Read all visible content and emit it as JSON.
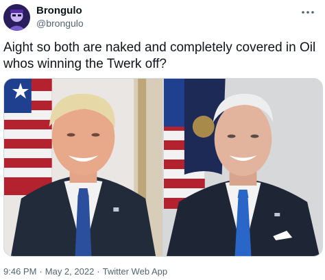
{
  "author": {
    "display_name": "Brongulo",
    "handle": "@brongulo",
    "avatar_icon": "avatar-icon"
  },
  "tweet": {
    "text_line1": "Aight so both are naked and completely covered in Oil",
    "text_line2": "whos winning the Twerk off?"
  },
  "media": {
    "photos": [
      {
        "icon": "portrait-photo-left"
      },
      {
        "icon": "portrait-photo-right"
      }
    ]
  },
  "meta": {
    "time": "9:46 PM",
    "separator": "·",
    "date": "May 2, 2022",
    "source": "Twitter Web App"
  },
  "colors": {
    "text_primary": "#0f1419",
    "text_secondary": "#536471",
    "border": "#cfd9de"
  }
}
